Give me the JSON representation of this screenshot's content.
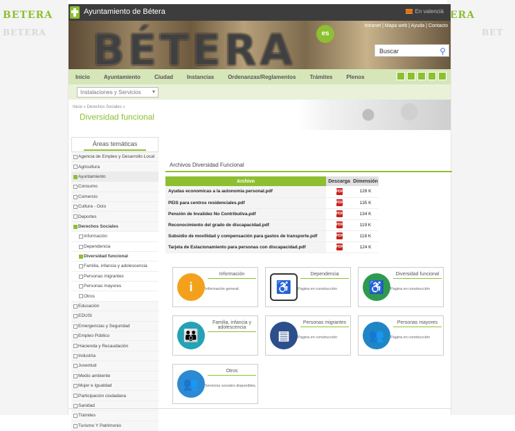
{
  "header": {
    "title": "Ayuntamiento de Bétera",
    "lang": "En valencià",
    "toplinks": "Intranet | Mapa web | Ayuda | Contacto",
    "banner_word": "BÉTERA",
    "badge": "es"
  },
  "side_logos": {
    "left_top": "BETERA",
    "left_bottom": "BETERA",
    "right_top": "ERA",
    "right_bottom": "BET"
  },
  "search": {
    "placeholder": "Buscar"
  },
  "nav": {
    "items": [
      "Inicio",
      "Ayuntamiento",
      "Ciudad",
      "Instancias",
      "Ordenanzas/Reglamentos",
      "Trámites",
      "Plenos"
    ]
  },
  "subbar": {
    "select": "Instalaciones y Servicios"
  },
  "breadcrumb": "Inicio » Derechos Sociales »",
  "page_title": "Diversidad funcional",
  "sidebar": {
    "title": "Áreas temáticas",
    "items": [
      {
        "label": "Agencia de Empleo y Desarrollo Local",
        "type": "item"
      },
      {
        "label": "Agricultura",
        "type": "item"
      },
      {
        "label": "Ayuntamiento",
        "type": "active"
      },
      {
        "label": "Consumo",
        "type": "item"
      },
      {
        "label": "Comercio",
        "type": "item"
      },
      {
        "label": "Cultura - Ocio",
        "type": "item"
      },
      {
        "label": "Deportes",
        "type": "item"
      },
      {
        "label": "Derechos Sociales",
        "type": "bold"
      },
      {
        "label": "Información",
        "type": "sub"
      },
      {
        "label": "Dependencia",
        "type": "sub"
      },
      {
        "label": "Diversidad funcional",
        "type": "subactive"
      },
      {
        "label": "Familia, infancia y adolescencia",
        "type": "sub"
      },
      {
        "label": "Personas migrantes",
        "type": "sub"
      },
      {
        "label": "Personas mayores",
        "type": "sub"
      },
      {
        "label": "Otros",
        "type": "sub"
      },
      {
        "label": "Educación",
        "type": "item"
      },
      {
        "label": "EDUSI",
        "type": "item"
      },
      {
        "label": "Emergencias y Seguridad",
        "type": "item"
      },
      {
        "label": "Empleo Público",
        "type": "item"
      },
      {
        "label": "Hacienda y Recaudación",
        "type": "item"
      },
      {
        "label": "Industria",
        "type": "item"
      },
      {
        "label": "Juventud",
        "type": "item"
      },
      {
        "label": "Medio ambiente",
        "type": "item"
      },
      {
        "label": "Mujer e Igualdad",
        "type": "item"
      },
      {
        "label": "Participación ciudadana",
        "type": "item"
      },
      {
        "label": "Sanidad",
        "type": "item"
      },
      {
        "label": "Trámites",
        "type": "item"
      },
      {
        "label": "Turismo Y Patrimonio",
        "type": "item"
      }
    ]
  },
  "files": {
    "heading": "Archivos Diversidad Funcional",
    "columns": [
      "Archivo",
      "Descarga",
      "Dimensión"
    ],
    "rows": [
      {
        "name": "Ayudas economicas a la autonomia personal.pdf",
        "size": "128 K"
      },
      {
        "name": "PEIS para centros residenciales.pdf",
        "size": "135 K"
      },
      {
        "name": "Pensión de Invalidez No Contributiva.pdf",
        "size": "134 K"
      },
      {
        "name": "Reconocimiento del grado de discapacidad.pdf",
        "size": "119 K"
      },
      {
        "name": "Subsidio de movilidad y compensación para gastos de transporte.pdf",
        "size": "118 K"
      },
      {
        "name": "Tarjeta de Estacionamiento para personas con discapacidad.pdf",
        "size": "124 K"
      }
    ],
    "pdf_label": "PDF"
  },
  "cards": [
    {
      "title": "Información",
      "desc": "Información general.",
      "icon": "info-icon",
      "color": "#f3a11c",
      "glyph": "i"
    },
    {
      "title": "Dependencia",
      "desc": "Pagina en construcción",
      "icon": "wheelchair-frame-icon",
      "color": "#ffffff",
      "glyph": "♿"
    },
    {
      "title": "Diversidad funcional",
      "desc": "Pagina en construcción",
      "icon": "wheelchair-icon",
      "color": "#2e9a4f",
      "glyph": "♿"
    },
    {
      "title": "Familia, infancia y adolescencia",
      "desc": "",
      "icon": "family-icon",
      "color": "#24a2b6",
      "glyph": "👪"
    },
    {
      "title": "Personas migrantes",
      "desc": "Pagina en construcción",
      "icon": "passport-icon",
      "color": "#2c4f8c",
      "glyph": "▤"
    },
    {
      "title": "Personas mayores",
      "desc": "Pagina en construcción",
      "icon": "elderly-icon",
      "color": "#1f86c6",
      "glyph": "👥"
    },
    {
      "title": "Otros",
      "desc": "Servicios sociales disponibles.",
      "icon": "people-icon",
      "color": "#2b8ad2",
      "glyph": "👥"
    }
  ]
}
